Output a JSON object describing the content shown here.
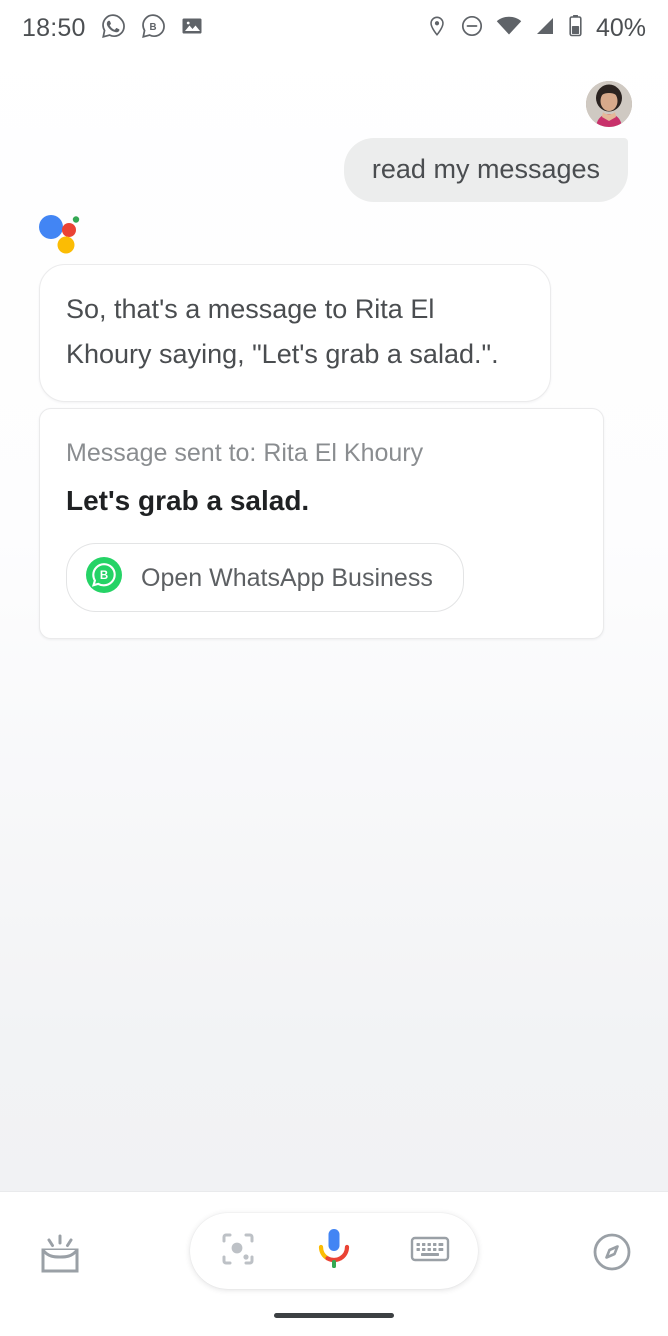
{
  "status_bar": {
    "time": "18:50",
    "battery_percent": "40%",
    "left_icons": [
      "whatsapp-icon",
      "whatsapp-business-icon",
      "photos-icon"
    ],
    "right_icons": [
      "location-icon",
      "do-not-disturb-icon",
      "wifi-icon",
      "cellular-signal-icon",
      "battery-icon"
    ]
  },
  "account": {
    "avatar_label": "Google account avatar"
  },
  "conversation": {
    "user_message": "read my messages",
    "assistant_response": "So, that's a message to Rita El Khoury saying, \"Let's grab a salad.\".",
    "assistant_logo": "google-assistant-logo"
  },
  "message_card": {
    "sent_to_label": "Message sent to: Rita El Khoury",
    "message_body": "Let's grab a salad.",
    "open_app_button": "Open WhatsApp Business",
    "app_icon": "whatsapp-business-icon"
  },
  "bottom_bar": {
    "snapshot_icon": "snapshot-icon",
    "lens_icon": "google-lens-icon",
    "mic_icon": "google-mic-icon",
    "keyboard_icon": "keyboard-icon",
    "explore_icon": "explore-compass-icon"
  },
  "colors": {
    "google_blue": "#4285F4",
    "google_red": "#EA4335",
    "google_yellow": "#FBBC04",
    "google_green": "#34A853",
    "whatsapp_green": "#25D366",
    "bubble_gray": "#ECEDED",
    "text_primary": "#1F2123",
    "text_secondary": "#4A4D50",
    "text_muted": "#8A8D90"
  }
}
